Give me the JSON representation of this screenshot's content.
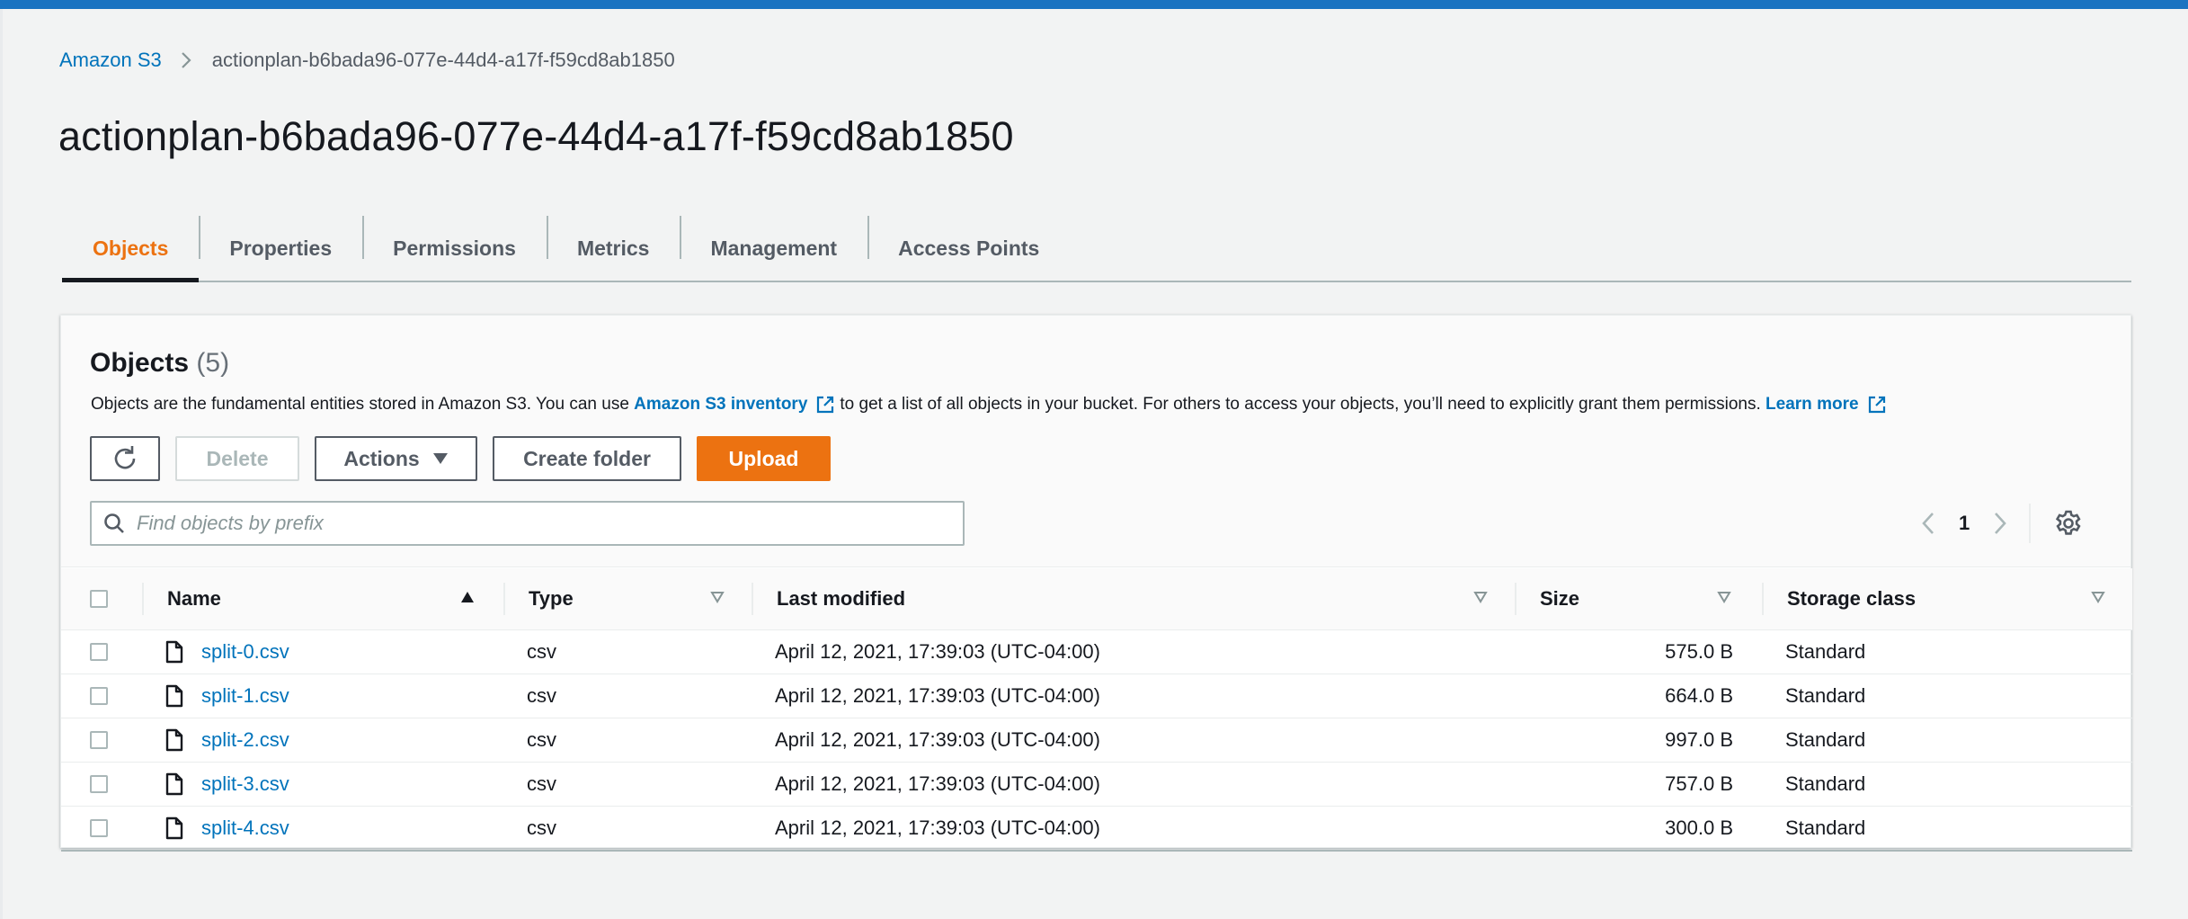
{
  "breadcrumb": {
    "root": "Amazon S3",
    "current": "actionplan-b6bada96-077e-44d4-a17f-f59cd8ab1850"
  },
  "page_title": "actionplan-b6bada96-077e-44d4-a17f-f59cd8ab1850",
  "tabs": [
    {
      "label": "Objects",
      "active": true
    },
    {
      "label": "Properties",
      "active": false
    },
    {
      "label": "Permissions",
      "active": false
    },
    {
      "label": "Metrics",
      "active": false
    },
    {
      "label": "Management",
      "active": false
    },
    {
      "label": "Access Points",
      "active": false
    }
  ],
  "objects_panel": {
    "title": "Objects",
    "count": "(5)",
    "description": {
      "part1": "Objects are the fundamental entities stored in Amazon S3. You can use",
      "inventory_link": "Amazon S3 inventory",
      "part2": "to get a list of all objects in your bucket. For others to access your objects, you’ll need to explicitly grant them permissions.",
      "learn_more": "Learn more"
    },
    "toolbar": {
      "refresh_icon": "refresh-icon",
      "delete": "Delete",
      "actions": "Actions",
      "create_folder": "Create folder",
      "upload": "Upload"
    },
    "search": {
      "placeholder": "Find objects by prefix",
      "value": ""
    },
    "pagination": {
      "page": "1"
    },
    "table": {
      "headers": {
        "name": "Name",
        "type": "Type",
        "last_modified": "Last modified",
        "size": "Size",
        "storage_class": "Storage class"
      },
      "rows": [
        {
          "name": "split-0.csv",
          "type": "csv",
          "last_modified": "April 12, 2021, 17:39:03 (UTC-04:00)",
          "size": "575.0 B",
          "storage_class": "Standard"
        },
        {
          "name": "split-1.csv",
          "type": "csv",
          "last_modified": "April 12, 2021, 17:39:03 (UTC-04:00)",
          "size": "664.0 B",
          "storage_class": "Standard"
        },
        {
          "name": "split-2.csv",
          "type": "csv",
          "last_modified": "April 12, 2021, 17:39:03 (UTC-04:00)",
          "size": "997.0 B",
          "storage_class": "Standard"
        },
        {
          "name": "split-3.csv",
          "type": "csv",
          "last_modified": "April 12, 2021, 17:39:03 (UTC-04:00)",
          "size": "757.0 B",
          "storage_class": "Standard"
        },
        {
          "name": "split-4.csv",
          "type": "csv",
          "last_modified": "April 12, 2021, 17:39:03 (UTC-04:00)",
          "size": "300.0 B",
          "storage_class": "Standard"
        }
      ]
    }
  },
  "colors": {
    "accent": "#ec7211",
    "link": "#0073bb",
    "top_bar": "#1a73c1"
  }
}
